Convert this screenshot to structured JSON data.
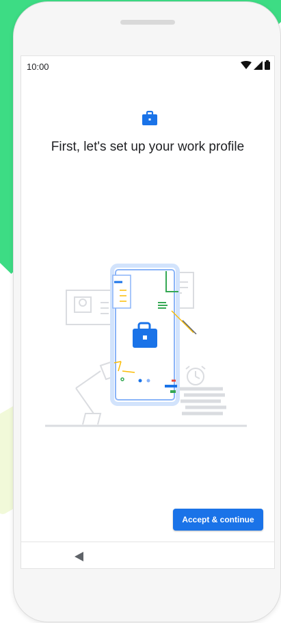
{
  "status_bar": {
    "time": "10:00",
    "icons": [
      "wifi-icon",
      "signal-icon",
      "battery-icon"
    ]
  },
  "setup": {
    "header_icon": "briefcase-icon",
    "title": "First, let's set up your work profile",
    "illustration_icon": "briefcase-icon"
  },
  "actions": {
    "accept_label": "Accept & continue"
  },
  "navigation": {
    "back_icon": "back-icon"
  },
  "colors": {
    "accent": "#1a73e8",
    "brand_green": "#3ddc84",
    "text": "#202124"
  }
}
